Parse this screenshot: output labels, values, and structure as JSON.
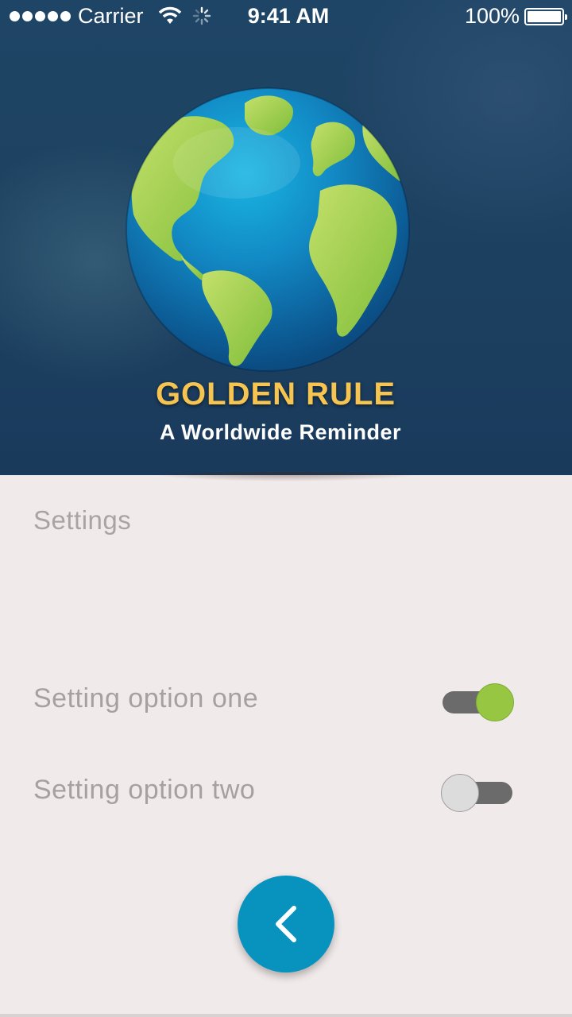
{
  "status_bar": {
    "carrier": "Carrier",
    "time": "9:41 AM",
    "battery": "100%",
    "icons": [
      "signal-dots-icon",
      "wifi-icon",
      "activity-spinner-icon",
      "battery-icon"
    ]
  },
  "hero": {
    "title": "GOLDEN RULE",
    "subtitle": "A Worldwide Reminder",
    "image": "globe-icon",
    "title_color": "#f6c451"
  },
  "settings": {
    "heading": "Settings",
    "options": [
      {
        "label": "Setting option one",
        "enabled": true
      },
      {
        "label": "Setting option two",
        "enabled": false
      }
    ]
  },
  "back_button": {
    "icon": "chevron-left-icon",
    "color": "#0893bf"
  },
  "colors": {
    "toggle_on": "#96c642",
    "toggle_track": "#6b6b6b",
    "background": "#f1eaea"
  }
}
